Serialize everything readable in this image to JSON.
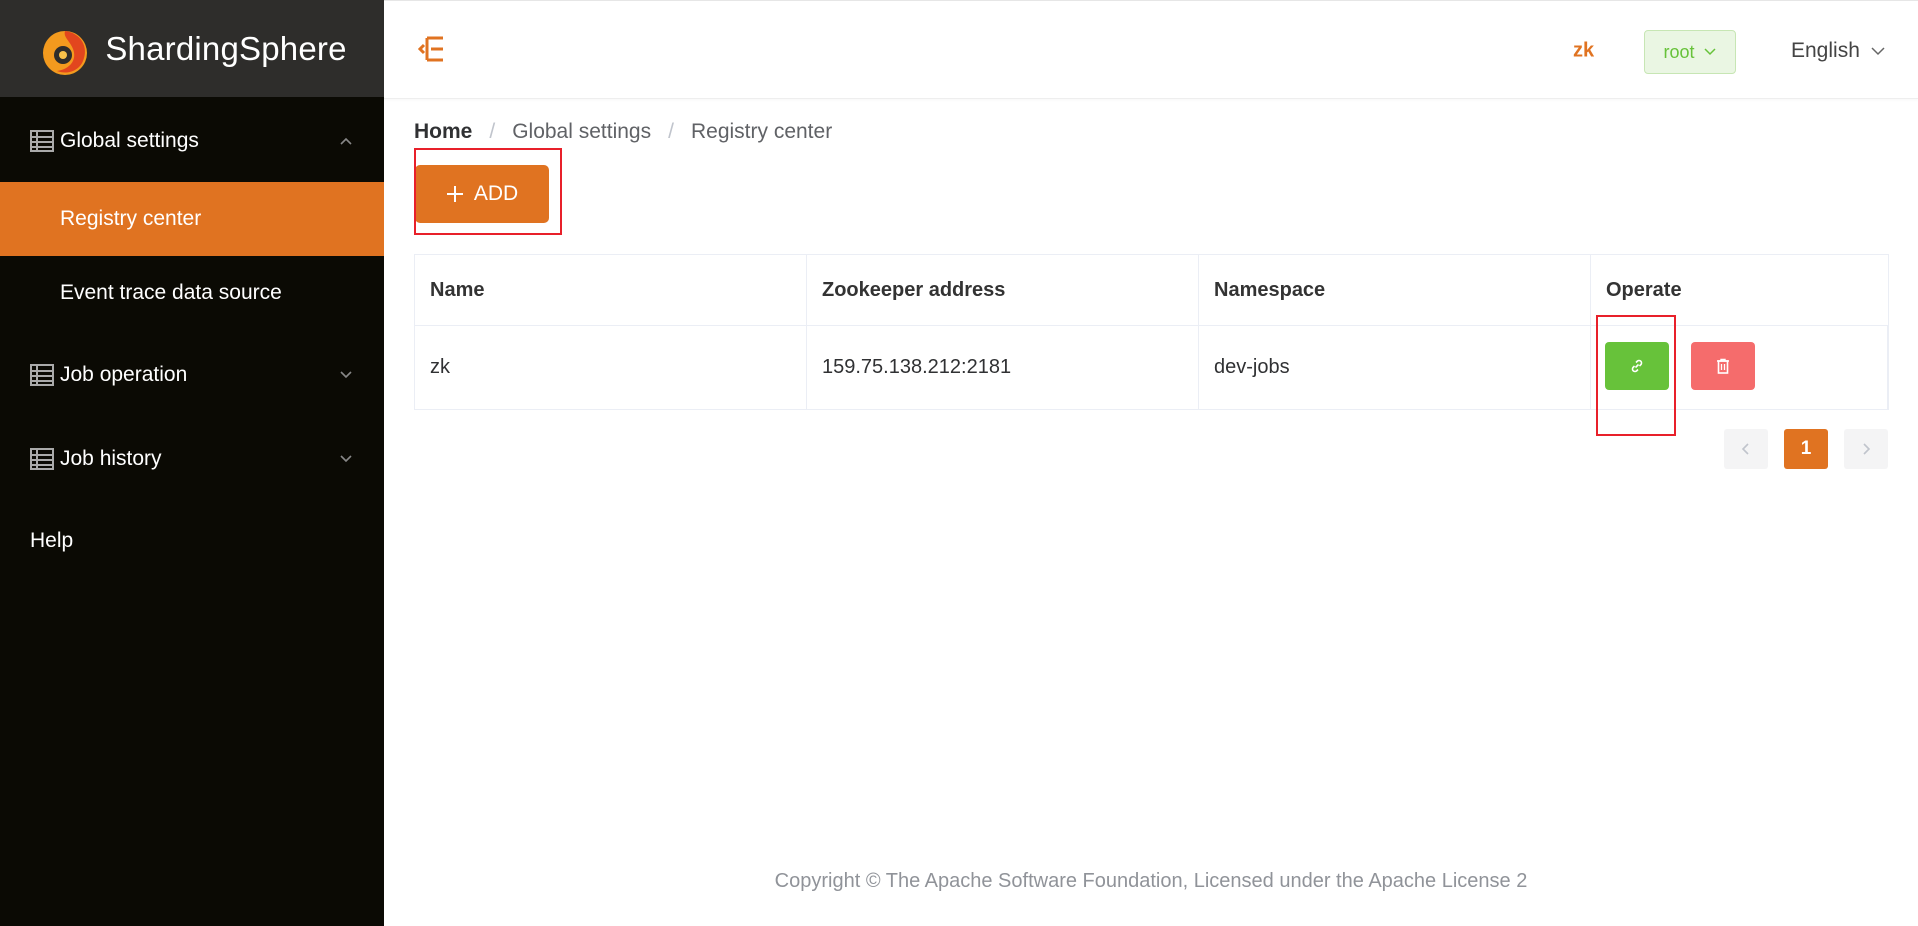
{
  "app": {
    "logo_text": "ShardingSphere"
  },
  "sidebar": {
    "groups": [
      {
        "label": "Global settings",
        "expanded": true
      },
      {
        "label": "Job operation",
        "expanded": false
      },
      {
        "label": "Job history",
        "expanded": false
      }
    ],
    "sub_items": [
      {
        "label": "Registry center",
        "active": true
      },
      {
        "label": "Event trace data source",
        "active": false
      }
    ],
    "help_label": "Help"
  },
  "header": {
    "registry_name": "zk",
    "user_label": "root",
    "language": "English"
  },
  "breadcrumb": [
    "Home",
    "Global settings",
    "Registry center"
  ],
  "toolbar": {
    "add_label": "ADD",
    "add_icon": "plus-icon"
  },
  "table": {
    "columns": [
      "Name",
      "Zookeeper address",
      "Namespace",
      "Operate"
    ],
    "rows": [
      {
        "name": "zk",
        "address": "159.75.138.212:2181",
        "namespace": "dev-jobs",
        "actions": [
          "link-icon",
          "trash-icon"
        ]
      }
    ]
  },
  "pagination": {
    "current_page": "1"
  },
  "footer": {
    "copyright": "Copyright © The Apache Software Foundation, Licensed under the Apache License 2"
  },
  "colors": {
    "accent": "#e07321",
    "success": "#67c23a",
    "danger": "#f56c6c",
    "sidebar_bg": "#0b0a04"
  }
}
